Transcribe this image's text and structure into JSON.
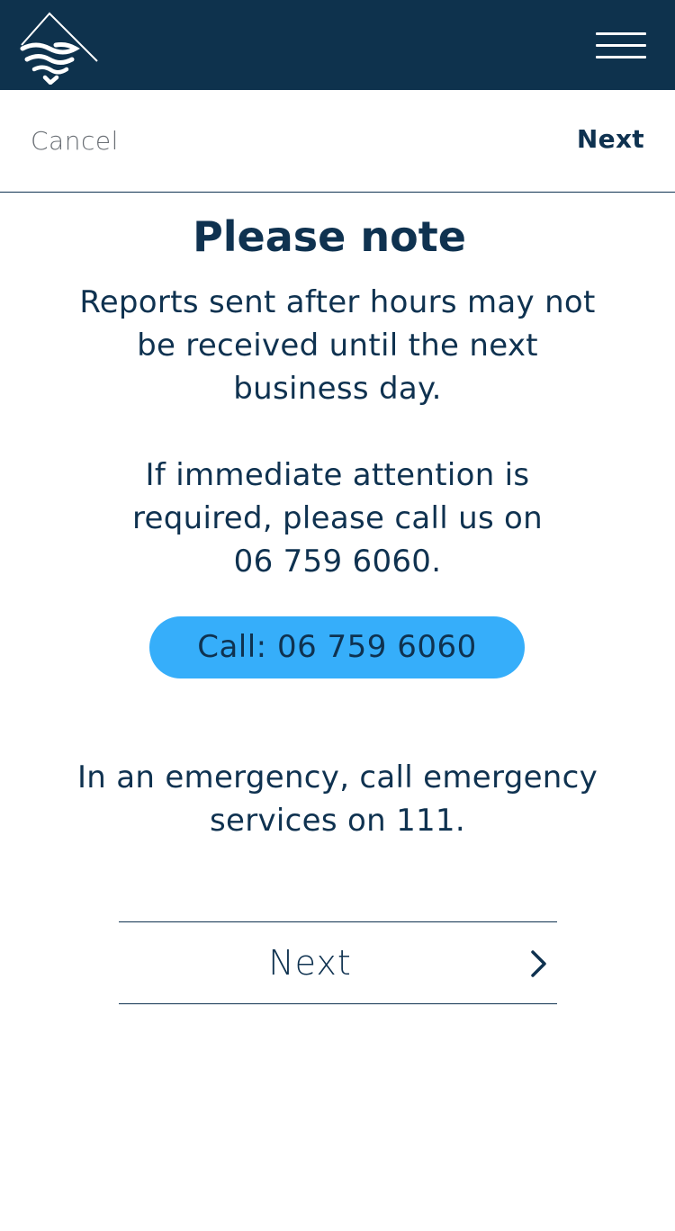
{
  "header": {
    "logo_icon": "mountain-wave-logo-icon",
    "menu_icon": "hamburger-menu-icon",
    "background_color": "#0e324d"
  },
  "actionbar": {
    "cancel_label": "Cancel",
    "next_label": "Next"
  },
  "main": {
    "title": "Please note",
    "after_hours_lines": [
      "Reports sent after hours may not",
      "be received until the next",
      "business day."
    ],
    "immediate_lines": [
      "If immediate attention is",
      "required, please call us on",
      "06 759 6060."
    ],
    "call_button_label": "Call: 06 759 6060",
    "call_button_color": "#36aefa",
    "emergency_lines": [
      "In an emergency, call emergency",
      "services on 111."
    ],
    "next_button_label": "Next",
    "next_button_icon": "chevron-right-icon"
  },
  "colors": {
    "primary_text": "#0f3250",
    "muted_text": "#6a6f75"
  }
}
